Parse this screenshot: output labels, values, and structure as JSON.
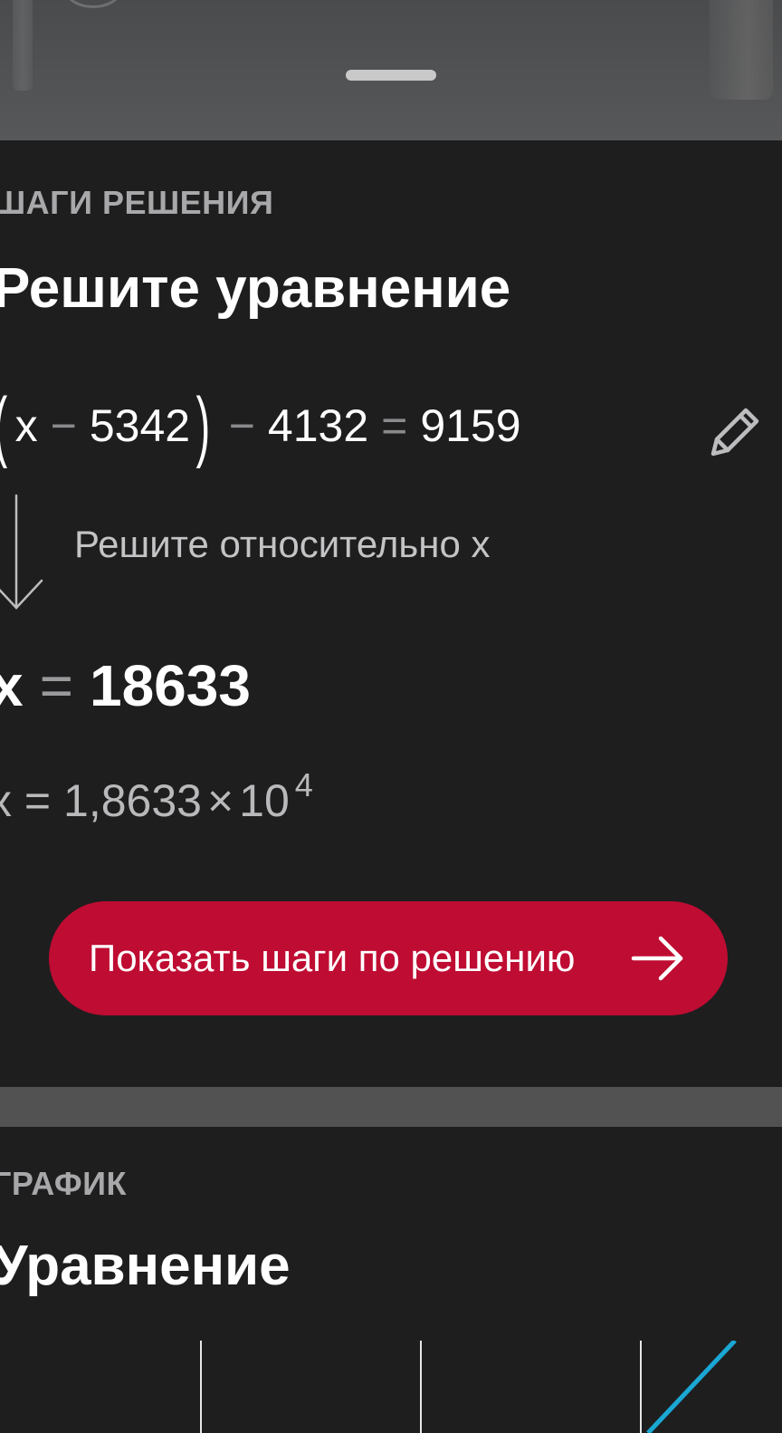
{
  "steps_card": {
    "section_label": "ШАГИ РЕШЕНИЯ",
    "title": "Решите уравнение",
    "equation": {
      "open_paren": "(",
      "x": "x",
      "minus1": "−",
      "a": "5342",
      "close_paren": ")",
      "minus2": "−",
      "b": "4132",
      "equals": "=",
      "c": "9159"
    },
    "step_hint": "Решите относительно x",
    "result": {
      "var": "x",
      "equals": "=",
      "value": "18633"
    },
    "scientific": {
      "lhs": "x",
      "equals": "=",
      "mantissa": "1,8633",
      "times": "×",
      "base": "10",
      "exponent": "4"
    },
    "cta_label": "Показать шаги по решению"
  },
  "graph_card": {
    "section_label": "ГРАФИК",
    "title": "Уравнение"
  },
  "icons": [
    "pencil-icon",
    "arrow-down-icon",
    "arrow-right-icon"
  ],
  "colors": {
    "background": "#1e1e1f",
    "accent": "#bf0c32",
    "graph_line": "#1aa7d4"
  }
}
